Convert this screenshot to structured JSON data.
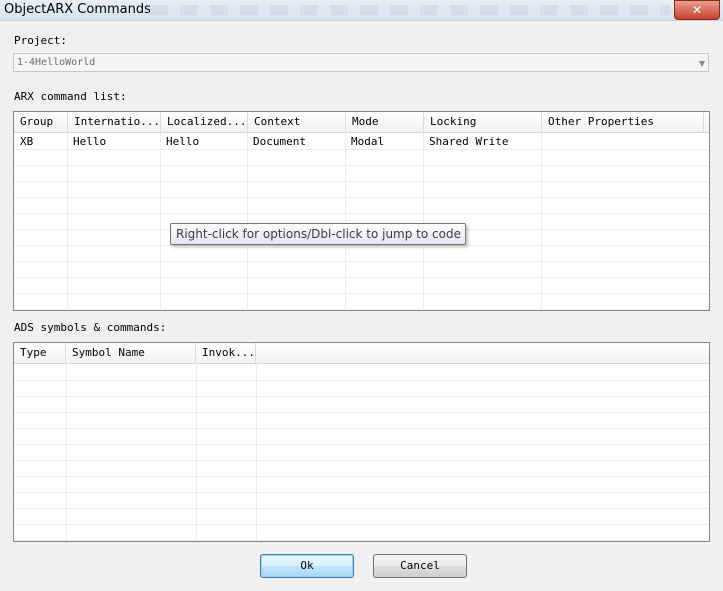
{
  "window": {
    "title": "ObjectARX Commands",
    "close_glyph": "✕"
  },
  "project": {
    "label": "Project:",
    "value": "1-4HelloWorld",
    "arrow": "▼"
  },
  "arx_list": {
    "label": "ARX command list:",
    "columns": [
      "Group",
      "Internatio...",
      "Localized...",
      "Context",
      "Mode",
      "Locking",
      "Other Properties"
    ],
    "rows": [
      [
        "XB",
        "Hello",
        "Hello",
        "Document",
        "Modal",
        "Shared Write",
        ""
      ]
    ]
  },
  "tooltip": {
    "text": "Right-click for options/Dbl-click to jump to code"
  },
  "ads_list": {
    "label": "ADS symbols & commands:",
    "columns": [
      "Type",
      "Symbol Name",
      "Invok..."
    ],
    "rows": []
  },
  "buttons": {
    "ok": "Ok",
    "cancel": "Cancel"
  }
}
